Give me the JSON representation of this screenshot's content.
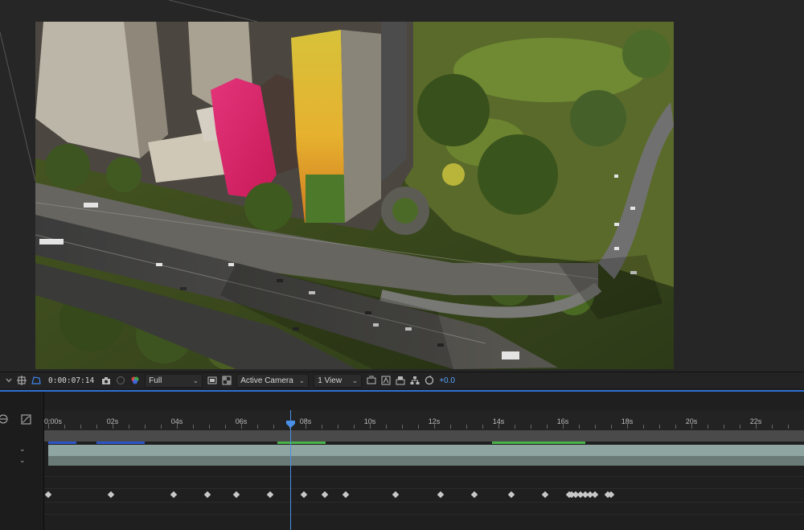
{
  "viewer": {
    "toolbar": {
      "timecode": "0:00:07:14",
      "resolution": "Full",
      "camera": "Active Camera",
      "view_layout": "1 View",
      "exposure": "+0.0",
      "icons": [
        "region-of-interest-icon",
        "transparency-grid-icon",
        "snapshot-icon",
        "show-snapshot-icon",
        "color-channel-icon",
        "fast-previews-icon",
        "3d-renderer-icon",
        "reset-exposure-icon"
      ]
    }
  },
  "timeline": {
    "ruler_labels": [
      "0:00s",
      "02s",
      "04s",
      "06s",
      "08s",
      "10s",
      "12s",
      "14s",
      "16s",
      "18s",
      "20s",
      "22s"
    ],
    "current_time_seconds": 7.58,
    "keyframe_times_seconds": [
      0.0,
      1.95,
      3.9,
      4.95,
      5.85,
      6.9,
      7.95,
      8.6,
      9.25,
      10.8,
      12.2,
      13.25,
      14.4,
      15.45,
      16.2,
      16.28,
      16.4,
      16.55,
      16.7,
      16.85,
      17.0,
      17.4,
      17.5
    ],
    "colors": {
      "playhead": "#4a8fe8",
      "layer_bar": "#8fa5a1",
      "cache_green": "#49b34a",
      "cache_blue": "#2d55c7"
    }
  }
}
